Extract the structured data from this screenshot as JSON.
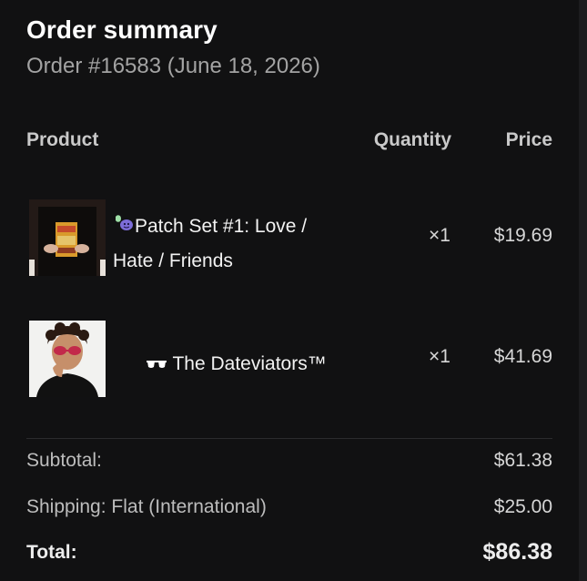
{
  "header": {
    "title": "Order summary",
    "subtitle": "Order #16583 (June 18, 2026)"
  },
  "table": {
    "columns": [
      "Product",
      "Quantity",
      "Price"
    ],
    "rows": [
      {
        "name": "Patch Set #1: Love / Hate / Friends",
        "icon": "patch-icon",
        "quantity": "×1",
        "price": "$19.69"
      },
      {
        "name": "The Dateviators™",
        "icon": "sunglasses-icon",
        "quantity": "×1",
        "price": "$41.69"
      }
    ]
  },
  "summary": {
    "subtotal_label": "Subtotal:",
    "subtotal_value": "$61.38",
    "shipping_label": "Shipping: Flat (International)",
    "shipping_value": "$25.00",
    "total_label": "Total:",
    "total_value": "$86.38"
  },
  "colors": {
    "background": "#111112",
    "text": "#ececec",
    "muted": "#a3a3a3"
  }
}
